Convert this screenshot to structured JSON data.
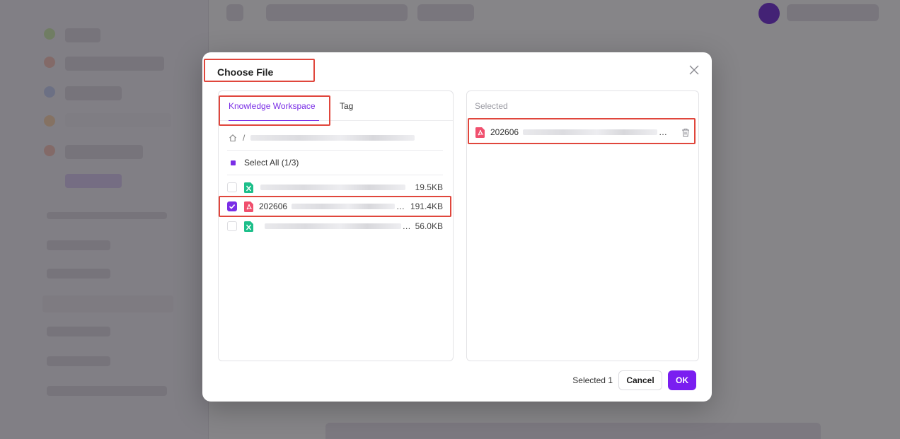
{
  "dialog": {
    "title": "Choose File",
    "tabs": [
      {
        "label": "Knowledge Workspace",
        "active": true
      },
      {
        "label": "Tag",
        "active": false
      }
    ],
    "breadcrumb_separator": "/",
    "select_all_label": "Select All (1/3)",
    "files": [
      {
        "name_visible": "",
        "size": "19.5KB",
        "type": "excel",
        "checked": false
      },
      {
        "name_visible": "202606",
        "size": "191.4KB",
        "type": "pdf",
        "checked": true
      },
      {
        "name_visible": "",
        "size": "56.0KB",
        "type": "excel",
        "checked": false
      }
    ],
    "selected_panel": {
      "label": "Selected",
      "items": [
        {
          "name_visible": "202606",
          "type": "pdf"
        }
      ]
    },
    "footer": {
      "selected_count": "Selected 1",
      "cancel_label": "Cancel",
      "ok_label": "OK"
    }
  },
  "colors": {
    "accent": "#7a1ef0",
    "highlight": "#e0463c",
    "pdf": "#f0506e",
    "excel": "#1dbf8a"
  }
}
